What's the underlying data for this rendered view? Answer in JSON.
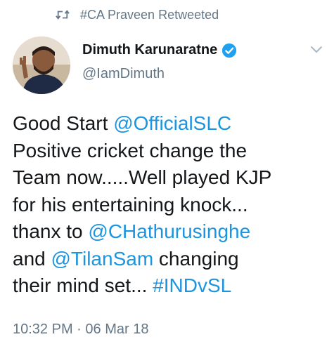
{
  "retweet": {
    "label": "#CA Praveen Retweeted"
  },
  "author": {
    "name": "Dimuth Karunaratne",
    "handle": "@IamDimuth",
    "verified": true
  },
  "tweet": {
    "lines": [
      [
        {
          "text": "Good Start ",
          "type": "text"
        },
        {
          "text": "@OfficialSLC",
          "type": "link"
        }
      ],
      [
        {
          "text": "Positive cricket change the",
          "type": "text"
        }
      ],
      [
        {
          "text": "Team now.....Well played KJP",
          "type": "text"
        }
      ],
      [
        {
          "text": "for his entertaining knock...",
          "type": "text"
        }
      ],
      [
        {
          "text": "thanx to ",
          "type": "text"
        },
        {
          "text": "@CHathurusinghe",
          "type": "link"
        }
      ],
      [
        {
          "text": "and ",
          "type": "text"
        },
        {
          "text": "@TilanSam",
          "type": "link"
        },
        {
          "text": " changing",
          "type": "text"
        }
      ],
      [
        {
          "text": "their mind set... ",
          "type": "text"
        },
        {
          "text": "#INDvSL",
          "type": "link"
        }
      ]
    ]
  },
  "meta": {
    "time": "10:32 PM",
    "separator": " · ",
    "date": "06 Mar 18"
  },
  "colors": {
    "link": "#1b95e0",
    "secondary_text": "#657786",
    "primary_text": "#14171a",
    "verified_badge": "#1da1f2"
  },
  "icons": {
    "retweet": "retweet-icon",
    "verified": "verified-badge-icon",
    "menu": "chevron-down-icon"
  }
}
